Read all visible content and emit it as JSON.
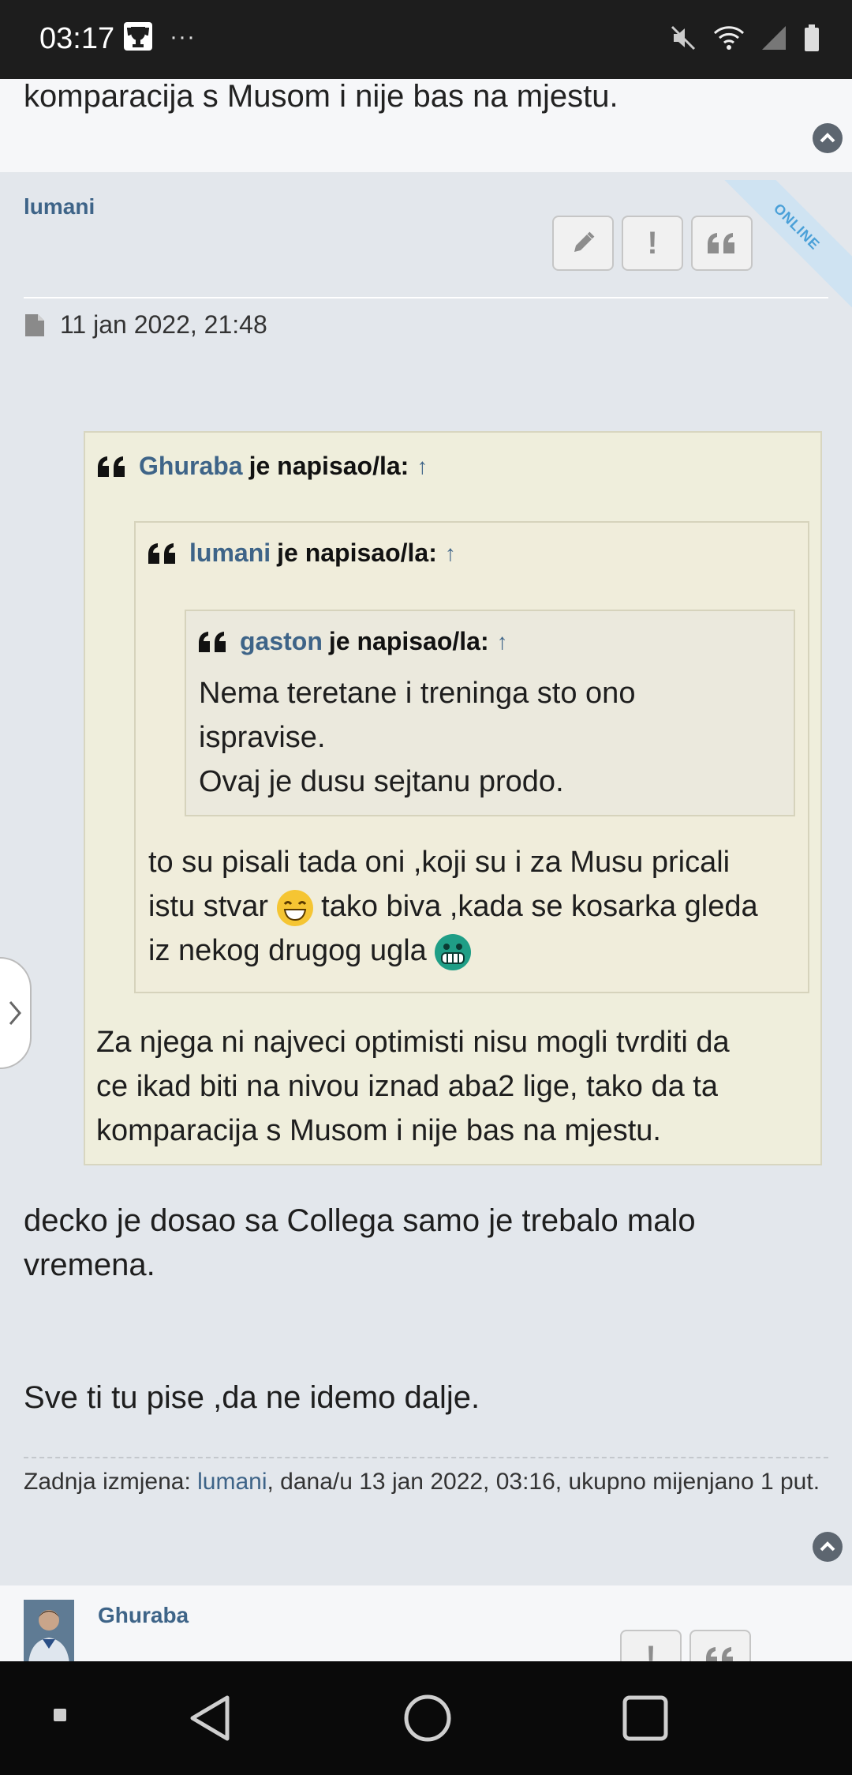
{
  "status_bar": {
    "time": "03:17",
    "dots": "···"
  },
  "previous_post": {
    "text_tail": "komparacija s Musom i nije bas na mjestu."
  },
  "post": {
    "author": "lumani",
    "online_badge": "ONLINE",
    "actions": {
      "edit_icon": "pencil-icon",
      "report_label": "!",
      "quote_label": "“"
    },
    "date": "11 jan 2022, 21:48",
    "quote_outer": {
      "author": "Ghuraba",
      "said": "je napisao/la:",
      "arrow": "↑",
      "quote_mid": {
        "author": "lumani",
        "said": "je napisao/la:",
        "arrow": "↑",
        "quote_inner": {
          "author": "gaston",
          "said": "je napisao/la:",
          "arrow": "↑",
          "line1": "Nema teretane i treninga sto ono",
          "line2": "ispravise.",
          "line3": "Ovaj je dusu sejtanu prodo."
        },
        "text_a": "to su pisali tada oni ,koji su i za Musu pricali",
        "text_b": "istu stvar",
        "text_c": "tako biva ,kada se kosarka gleda",
        "text_d": "iz nekog drugog ugla"
      },
      "text_line1": "Za njega ni najveci optimisti nisu mogli tvrditi da",
      "text_line2": "ce ikad biti na nivou iznad aba2 lige, tako da ta",
      "text_line3": "komparacija s Musom i nije bas na mjestu."
    },
    "body_line1": "decko je dosao sa Collega samo je trebalo malo",
    "body_line2": "vremena.",
    "body_line3": "Sve ti tu pise ,da ne idemo dalje.",
    "edit_note": {
      "prefix": "Zadnja izmjena: ",
      "user": "lumani",
      "suffix": ", dana/u 13 jan 2022, 03:16, ukupno mijenjano 1 put."
    }
  },
  "next_post": {
    "author": "Ghuraba",
    "report_label": "!",
    "quote_label": "“"
  },
  "colors": {
    "link": "#3e6488",
    "quote_bg": "#efeedc",
    "post_bg": "#e3e7ec"
  }
}
